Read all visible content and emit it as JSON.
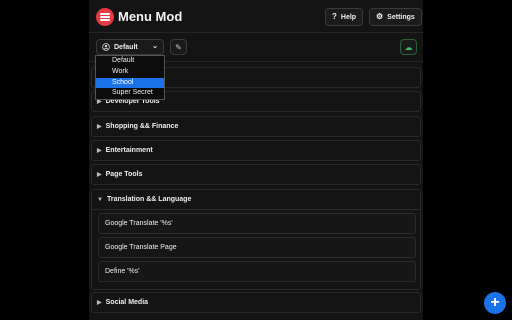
{
  "app": {
    "title": "Menu Mod"
  },
  "header": {
    "help_label": "Help",
    "settings_label": "Settings"
  },
  "toolbar": {
    "profile_selected": "Default",
    "profiles": [
      "Default",
      "Work",
      "School",
      "Super Secret"
    ],
    "highlighted_profile": "School"
  },
  "sections": [
    {
      "label": "Developer Tools",
      "expanded": false
    },
    {
      "label": "Shopping && Finance",
      "expanded": false
    },
    {
      "label": "Entertainment",
      "expanded": false
    },
    {
      "label": "Page Tools",
      "expanded": false
    },
    {
      "label": "Translation && Language",
      "expanded": true,
      "items": [
        "Google Translate '%s'",
        "Google Translate Page",
        "Define '%s'"
      ]
    },
    {
      "label": "Social Media",
      "expanded": false
    }
  ],
  "colors": {
    "accent": "#1a73e8",
    "logo": "#e53946",
    "sync": "#3fbf5a"
  },
  "icons": {
    "logo": "hamburger-menu-icon",
    "help": "question-icon",
    "settings": "gear-icon",
    "profile": "user-circle-icon",
    "rename": "edit-icon",
    "sync": "cloud-sync-icon",
    "add": "plus-icon"
  }
}
